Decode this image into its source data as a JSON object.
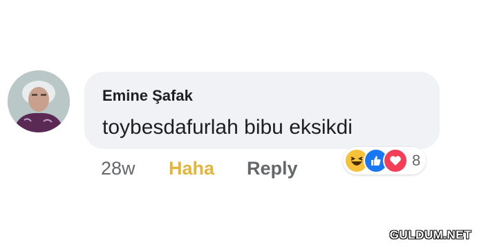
{
  "comment": {
    "author": "Emine Şafak",
    "text": "toybesdafurlah bibu eksikdi",
    "timestamp": "28w",
    "reaction_label": "Haha",
    "reply_label": "Reply",
    "reactions": {
      "icons": [
        "haha-icon",
        "like-icon",
        "love-icon"
      ],
      "count": "8"
    }
  },
  "colors": {
    "bubble_bg": "#f0f2f5",
    "haha_yellow": "#e3b53b",
    "meta_gray": "#65676b",
    "like_blue": "#1877f2",
    "love_red": "#f33e58"
  },
  "watermark": "GULDUM.NET"
}
